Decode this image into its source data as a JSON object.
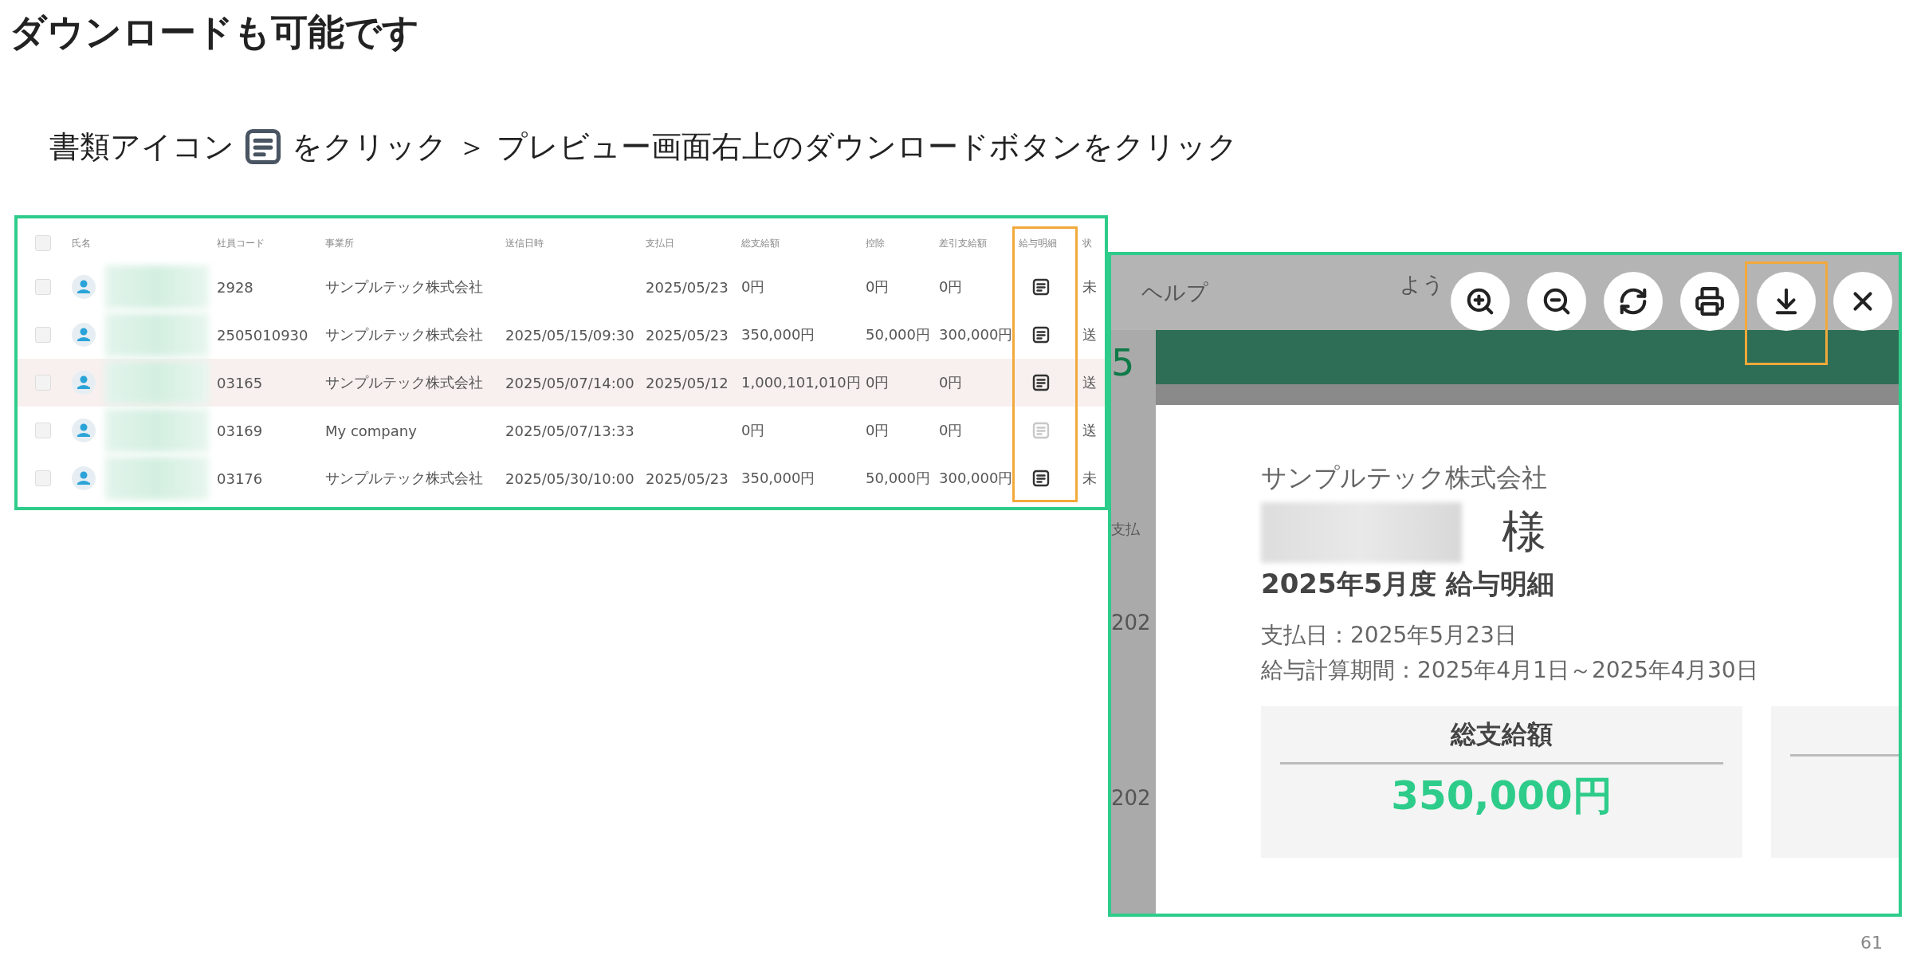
{
  "title": "ダウンロードも可能です",
  "instruction": {
    "before": "書類アイコン",
    "after": "をクリック ＞ プレビュー画面右上のダウンロードボタンをクリック"
  },
  "table": {
    "header_checked": false,
    "columns": [
      {
        "label": "氏名",
        "highlighted": false
      },
      {
        "label": "社員コード",
        "highlighted": false
      },
      {
        "label": "事業所",
        "highlighted": false
      },
      {
        "label": "送信日時",
        "highlighted": false
      },
      {
        "label": "支払日",
        "highlighted": false
      },
      {
        "label": "総支給額",
        "highlighted": false
      },
      {
        "label": "控除",
        "highlighted": false
      },
      {
        "label": "差引支給額",
        "highlighted": false
      },
      {
        "label": "給与明細",
        "highlighted": true
      },
      {
        "label": "状",
        "highlighted": false
      }
    ],
    "rows": [
      {
        "checked": false,
        "selected": false,
        "code": "2928",
        "office": "サンプルテック株式会社",
        "sent": "",
        "pay_date": "2025/05/23",
        "total": "0円",
        "deduction": "0円",
        "net": "0円",
        "slip_disabled": false,
        "status": "未"
      },
      {
        "checked": false,
        "selected": false,
        "code": "2505010930",
        "office": "サンプルテック株式会社",
        "sent": "2025/05/15/09:30",
        "pay_date": "2025/05/23",
        "total": "350,000円",
        "deduction": "50,000円",
        "net": "300,000円",
        "slip_disabled": false,
        "status": "送"
      },
      {
        "checked": false,
        "selected": true,
        "code": "03165",
        "office": "サンプルテック株式会社",
        "sent": "2025/05/07/14:00",
        "pay_date": "2025/05/12",
        "total": "1,000,101,010円",
        "deduction": "0円",
        "net": "0円",
        "slip_disabled": false,
        "status": "送"
      },
      {
        "checked": false,
        "selected": false,
        "code": "03169",
        "office": "My company",
        "sent": "2025/05/07/13:33",
        "pay_date": "",
        "total": "0円",
        "deduction": "0円",
        "net": "0円",
        "slip_disabled": true,
        "status": "送"
      },
      {
        "checked": false,
        "selected": false,
        "code": "03176",
        "office": "サンプルテック株式会社",
        "sent": "2025/05/30/10:00",
        "pay_date": "2025/05/23",
        "total": "350,000円",
        "deduction": "50,000円",
        "net": "300,000円",
        "slip_disabled": false,
        "status": "未"
      }
    ]
  },
  "preview": {
    "help": "ヘルプ",
    "greeting": "よう",
    "toolbar": [
      {
        "kind": "zoom-in",
        "highlighted": false
      },
      {
        "kind": "zoom-out",
        "highlighted": false
      },
      {
        "kind": "rotate",
        "highlighted": false
      },
      {
        "kind": "print",
        "highlighted": false
      },
      {
        "kind": "download",
        "highlighted": true
      },
      {
        "kind": "close",
        "highlighted": false
      }
    ],
    "side": [
      "5",
      "支払",
      "202",
      "202"
    ],
    "document": {
      "company": "サンプルテック株式会社",
      "honorific": "様",
      "heading": "2025年5月度 給与明細",
      "pay_date": "支払日：2025年5月23日",
      "period": "給与計算期間：2025年4月1日～2025年4月30日",
      "cards": [
        {
          "label": "総支給額",
          "amount": "350,000円"
        }
      ]
    }
  },
  "page_number": "61"
}
